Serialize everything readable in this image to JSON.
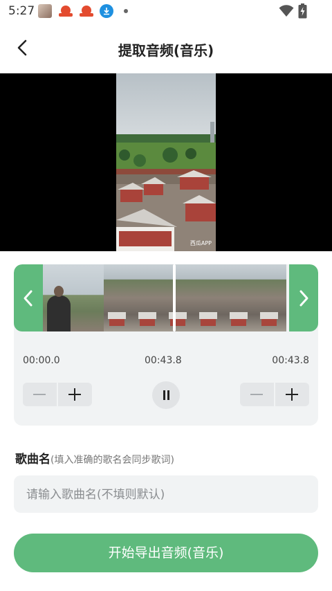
{
  "status_bar": {
    "time": "5:27",
    "icons": [
      "photo-notification-icon",
      "app-notification-icon",
      "app-notification-icon",
      "download-icon",
      "more-notifications-dot",
      "wifi-icon",
      "battery-charging-icon"
    ]
  },
  "header": {
    "title": "提取音频(音乐)",
    "back_icon": "chevron-left-icon"
  },
  "video": {
    "watermark": "西瓜APP"
  },
  "trimmer": {
    "start_time": "00:00.0",
    "current_time": "00:43.8",
    "end_time": "00:43.8",
    "left_handle_icon": "chevron-left-icon",
    "right_handle_icon": "chevron-right-icon",
    "pause_icon": "pause-icon"
  },
  "song": {
    "label": "歌曲名",
    "hint": "(填入准确的歌名会同步歌词)",
    "placeholder": "请输入歌曲名(不填则默认)",
    "value": ""
  },
  "export_button": "开始导出音频(音乐)",
  "colors": {
    "accent": "#5fba7d",
    "panel_bg": "#f1f3f4"
  }
}
